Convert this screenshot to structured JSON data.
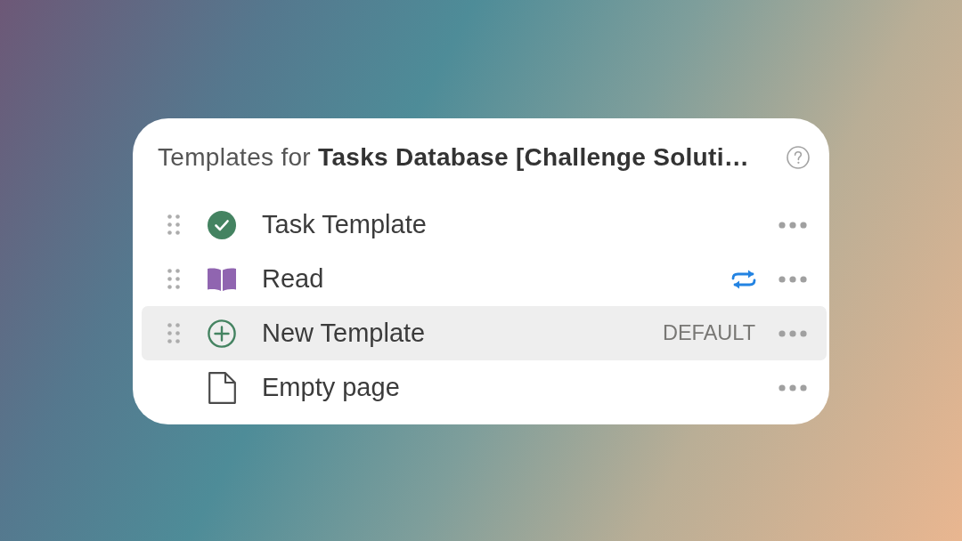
{
  "dialog": {
    "title": "Templates for **Tasks Database [Challenge Soluti…**"
  },
  "templates": [
    {
      "kind": "check",
      "name": "Task Template",
      "draggable": true,
      "repeating": false,
      "selected": false
    },
    {
      "kind": "book",
      "name": "Read",
      "draggable": true,
      "repeating": true,
      "selected": false
    },
    {
      "kind": "plus",
      "name": "New Template",
      "draggable": true,
      "repeating": false,
      "badge": "DEFAULT",
      "selected": true
    },
    {
      "kind": "page",
      "name": "Empty page",
      "draggable": false,
      "repeating": false,
      "selected": false
    }
  ]
}
